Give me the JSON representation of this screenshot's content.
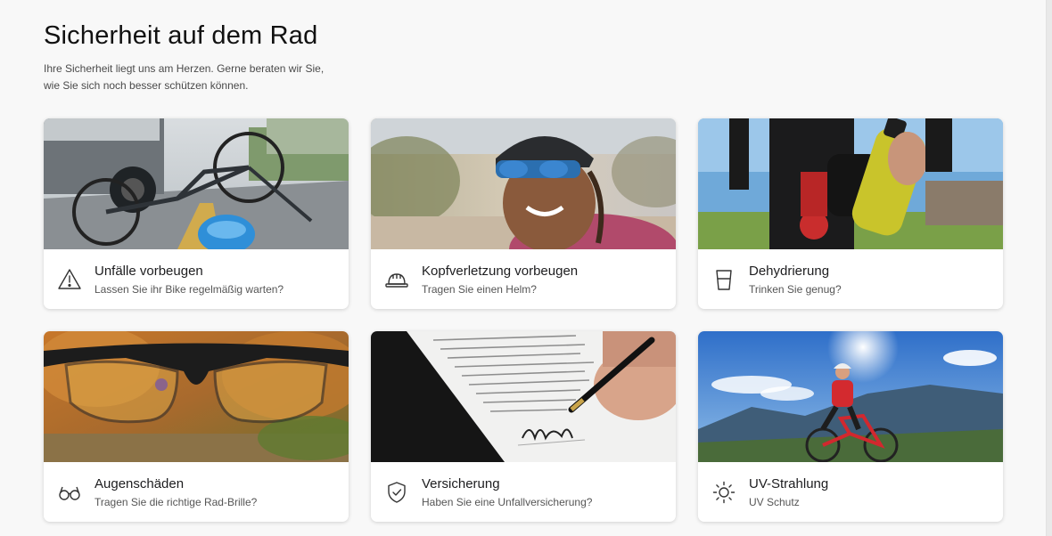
{
  "page": {
    "title": "Sicherheit auf dem Rad",
    "subtitle_line1": "Ihre Sicherheit liegt uns am Herzen. Gerne beraten wir Sie,",
    "subtitle_line2": "wie Sie sich noch besser schützen können."
  },
  "cards": [
    {
      "title": "Unfälle vorbeugen",
      "description": "Lassen Sie ihr Bike regelmäßig warten?",
      "icon": "warning-triangle-icon"
    },
    {
      "title": "Kopfverletzung vorbeugen",
      "description": "Tragen Sie einen Helm?",
      "icon": "helmet-icon"
    },
    {
      "title": "Dehydrierung",
      "description": "Trinken Sie genug?",
      "icon": "water-glass-icon"
    },
    {
      "title": "Augenschäden",
      "description": "Tragen Sie die richtige Rad-Brille?",
      "icon": "glasses-icon"
    },
    {
      "title": "Versicherung",
      "description": "Haben Sie eine Unfallversicherung?",
      "icon": "shield-check-icon"
    },
    {
      "title": "UV-Strahlung",
      "description": "UV Schutz",
      "icon": "sun-icon"
    }
  ]
}
